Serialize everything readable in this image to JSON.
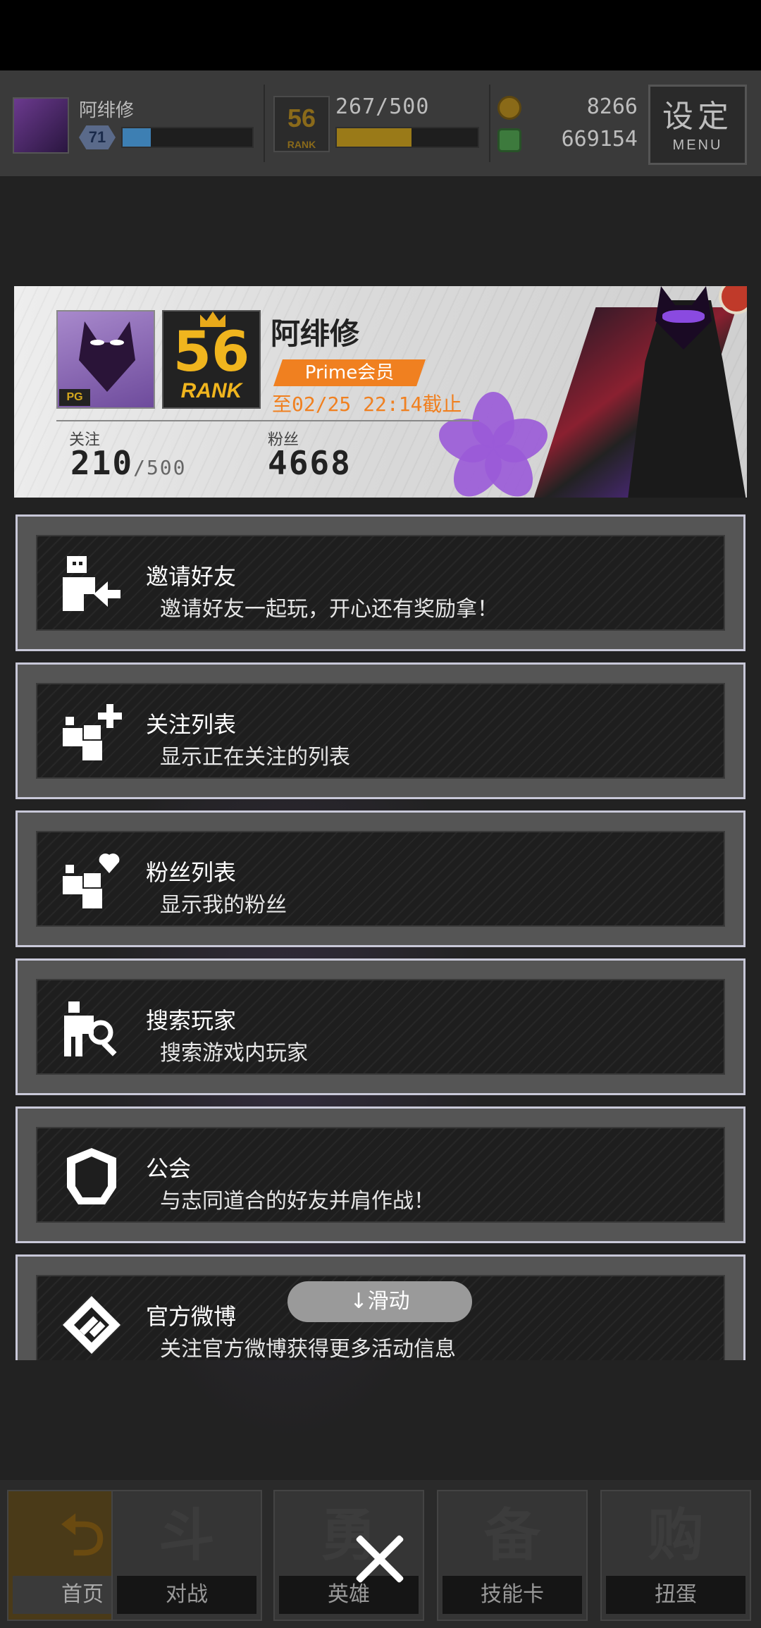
{
  "header": {
    "player_name": "阿绯修",
    "level": "71",
    "xp_fraction": 0.22,
    "rank": "56",
    "rank_label": "RANK",
    "stamina": "267/500",
    "stamina_fraction": 0.53,
    "gold": "8266",
    "green_currency": "669154",
    "menu_big": "设定",
    "menu_small": "MENU"
  },
  "profile": {
    "name": "阿绯修",
    "rank": "56",
    "rank_label": "RANK",
    "pg_badge": "PG",
    "membership": "Prime会员",
    "expires": "至02/25 22:14截止",
    "following_label": "关注",
    "following_value": "210",
    "following_max": "/500",
    "fans_label": "粉丝",
    "fans_value": "4668"
  },
  "menu_items": [
    {
      "title": "邀请好友",
      "desc": "邀请好友一起玩，开心还有奖励拿！",
      "icon": "invite-friend-icon"
    },
    {
      "title": "关注列表",
      "desc": "显示正在关注的列表",
      "icon": "follow-list-icon"
    },
    {
      "title": "粉丝列表",
      "desc": "显示我的粉丝",
      "icon": "fans-list-icon"
    },
    {
      "title": "搜索玩家",
      "desc": "搜索游戏内玩家",
      "icon": "search-player-icon"
    },
    {
      "title": "公会",
      "desc": "与志同道合的好友并肩作战！",
      "icon": "guild-shield-icon"
    },
    {
      "title": "官方微博",
      "desc": "关注官方微博获得更多活动信息",
      "icon": "weibo-icon"
    }
  ],
  "scroll_hint": "↓滑动",
  "bottom_nav": [
    {
      "label": "首页",
      "glyph": "⮌",
      "active": true
    },
    {
      "label": "对战",
      "glyph": "斗"
    },
    {
      "label": "英雄",
      "glyph": "勇"
    },
    {
      "label": "技能卡",
      "glyph": "备"
    },
    {
      "label": "扭蛋",
      "glyph": "购"
    }
  ],
  "colors": {
    "accent_orange": "#f08020",
    "rank_gold": "#f0b51e",
    "card_border": "#c8c8d8"
  }
}
